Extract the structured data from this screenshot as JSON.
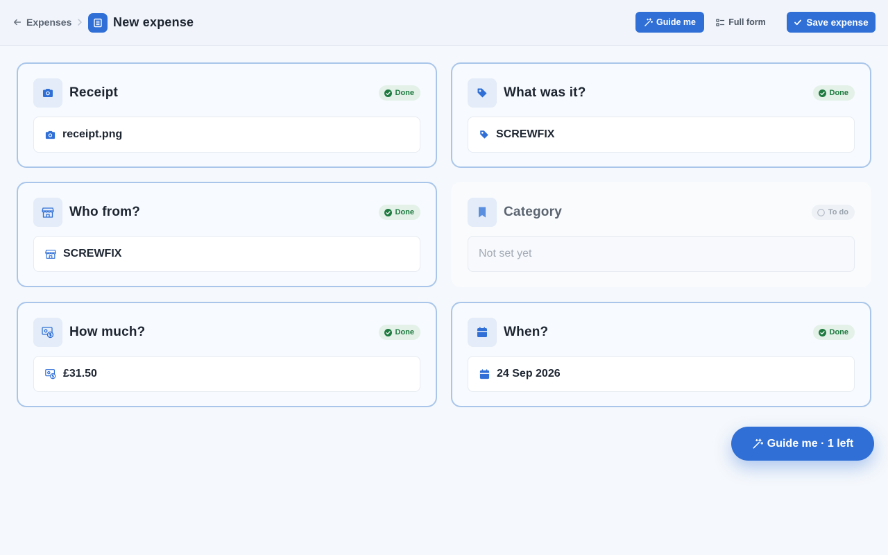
{
  "header": {
    "back_label": "Expenses",
    "title": "New expense",
    "guide_label": "Guide me",
    "full_form_label": "Full form",
    "save_label": "Save expense"
  },
  "cards": [
    {
      "id": "receipt",
      "title": "Receipt",
      "status": "Done",
      "value": "receipt.png",
      "icon": "camera-icon"
    },
    {
      "id": "what",
      "title": "What was it?",
      "status": "Done",
      "value": "SCREWFIX",
      "icon": "tag-icon"
    },
    {
      "id": "who",
      "title": "Who from?",
      "status": "Done",
      "value": "SCREWFIX",
      "icon": "store-icon"
    },
    {
      "id": "category",
      "title": "Category",
      "status": "To do",
      "value": "Not set yet",
      "icon": "bookmark-icon"
    },
    {
      "id": "amount",
      "title": "How much?",
      "status": "Done",
      "value": "£31.50",
      "icon": "money-icon"
    },
    {
      "id": "date",
      "title": "When?",
      "status": "Done",
      "value": "24 Sep 2026",
      "icon": "calendar-icon"
    }
  ],
  "floating": {
    "guide_label": "Guide me · 1 left"
  },
  "colors": {
    "accent": "#2f6fd6",
    "done_bg": "#e3f1e8",
    "done_text": "#1e7a3f",
    "card_border": "#a9c6ea"
  }
}
